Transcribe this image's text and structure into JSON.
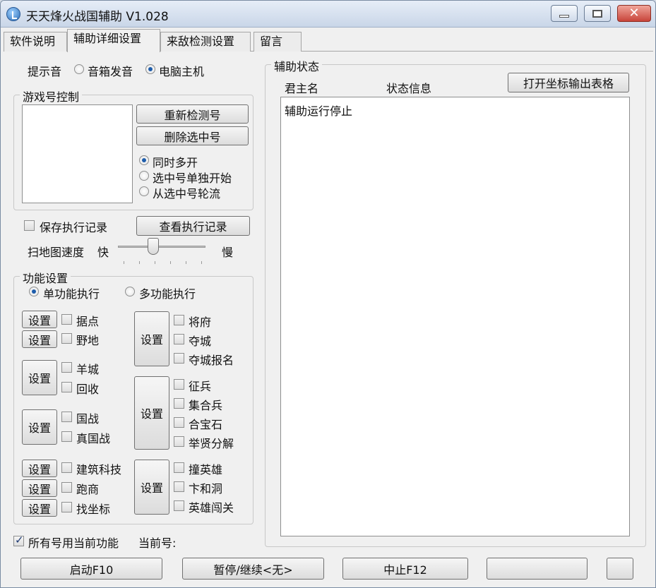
{
  "window": {
    "title": "天天烽火战国辅助 V1.028"
  },
  "tabs": [
    {
      "label": "软件说明"
    },
    {
      "label": "辅助详细设置"
    },
    {
      "label": "来敌检测设置"
    },
    {
      "label": "留言"
    }
  ],
  "sound": {
    "label": "提示音",
    "options": [
      "音箱发音",
      "电脑主机"
    ],
    "selected": "电脑主机"
  },
  "game_accounts": {
    "title": "游戏号控制",
    "recheck_button": "重新检测号",
    "delete_button": "删除选中号",
    "modes": [
      "同时多开",
      "选中号单独开始",
      "从选中号轮流"
    ],
    "selected_mode": "同时多开"
  },
  "log": {
    "save_label": "保存执行记录",
    "save_checked": false,
    "view_button": "查看执行记录"
  },
  "scan_speed": {
    "label": "扫地图速度",
    "fast": "快",
    "slow": "慢"
  },
  "functions": {
    "title": "功能设置",
    "single": "单功能执行",
    "multi": "多功能执行",
    "selected": "单功能执行",
    "settings_label": "设置",
    "left": {
      "judian": "据点",
      "yedi": "野地",
      "yangcheng": "羊城",
      "huishou": "回收",
      "guozhan": "国战",
      "zhenguozhan": "真国战",
      "jianzhu": "建筑科技",
      "paoshang": "跑商",
      "zhaozuobiao": "找坐标"
    },
    "right": {
      "jiangfu": "将府",
      "duocheng": "夺城",
      "duochengbaoming": "夺城报名",
      "zhengbing": "征兵",
      "jihebing": "集合兵",
      "hebaoshi": "合宝石",
      "juxian": "举贤分解",
      "zhuangyingxiong": "撞英雄",
      "bianhedong": "卞和洞",
      "yingxiongchuangguan": "英雄闯关"
    }
  },
  "all_accounts": {
    "label": "所有号用当前功能",
    "checked": true,
    "current_label": "当前号:"
  },
  "status": {
    "title": "辅助状态",
    "col_lord": "君主名",
    "col_info": "状态信息",
    "export_button": "打开坐标输出表格",
    "message": "辅助运行停止"
  },
  "bottom": {
    "start": "启动F10",
    "pause": "暂停/继续<无>",
    "stop": "中止F12"
  }
}
